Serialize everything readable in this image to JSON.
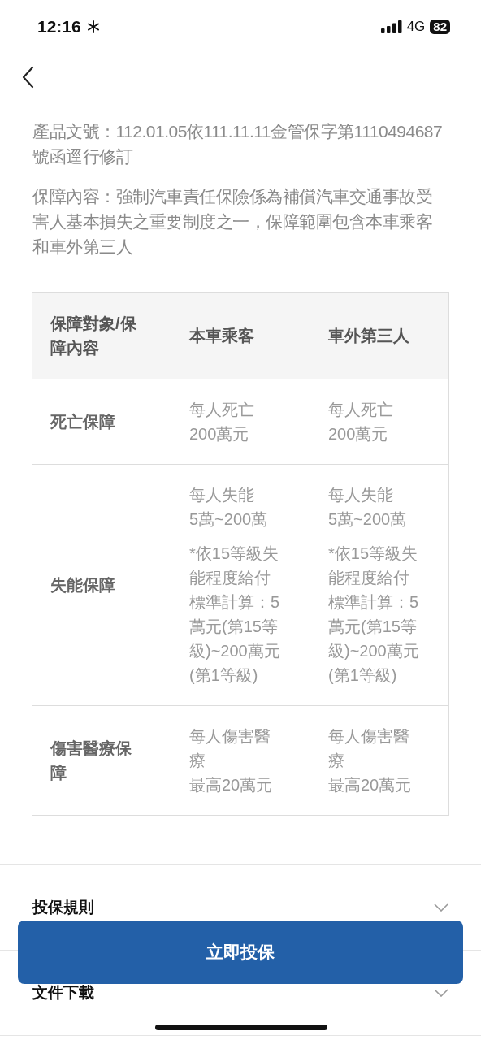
{
  "status_bar": {
    "time": "12:16",
    "network": "4G",
    "battery": "82"
  },
  "intro": [
    "產品文號：112.01.05依111.11.11金管保字第1110494687號函逕行修訂",
    "保障內容：強制汽車責任保險係為補償汽車交通事故受害人基本損失之重要制度之一，保障範圍包含本車乘客和車外第三人"
  ],
  "table": {
    "columns": [
      "保障對象/保障內容",
      "本車乘客",
      "車外第三人"
    ],
    "rows": [
      {
        "cells": [
          [
            [
              "死亡保障"
            ]
          ],
          [
            [
              "每人死亡",
              "200萬元"
            ]
          ],
          [
            [
              "每人死亡",
              "200萬元"
            ]
          ]
        ]
      },
      {
        "cells": [
          [
            [
              "失能保障"
            ]
          ],
          [
            [
              "每人失能",
              "5萬~200萬"
            ],
            [
              "*依15等級失能程度給付標準計算：5萬元(第15等級)~200萬元(第1等級)"
            ]
          ],
          [
            [
              "每人失能",
              "5萬~200萬"
            ],
            [
              "*依15等級失能程度給付標準計算：5萬元(第15等級)~200萬元(第1等級)"
            ]
          ]
        ]
      },
      {
        "cells": [
          [
            [
              "傷害醫療保障"
            ]
          ],
          [
            [
              "每人傷害醫療",
              "最高20萬元"
            ]
          ],
          [
            [
              "每人傷害醫療",
              "最高20萬元"
            ]
          ]
        ]
      }
    ]
  },
  "sections": [
    {
      "title": "投保規則",
      "expanded": false
    },
    {
      "title": "文件下載",
      "expanded": false
    }
  ],
  "cta": "立即投保"
}
